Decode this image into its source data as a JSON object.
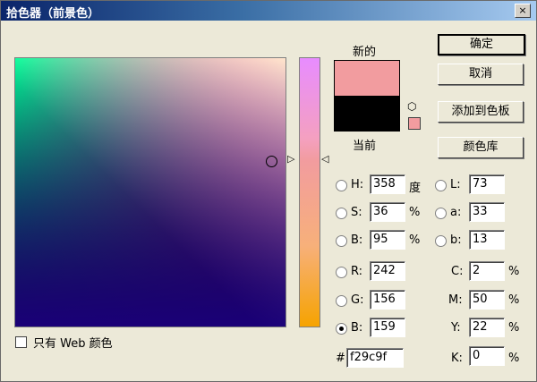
{
  "window": {
    "title": "拾色器（前景色）",
    "close_icon": "×"
  },
  "swatches": {
    "new_label": "新的",
    "current_label": "当前",
    "new_color": "#f29c9f",
    "current_color": "#000000",
    "gamut_color": "#f29c9f"
  },
  "buttons": {
    "ok": "确定",
    "cancel": "取消",
    "add_to_swatches": "添加到色板",
    "color_libraries": "颜色库"
  },
  "hsb": {
    "h_label": "H:",
    "h_value": "358",
    "h_unit": "度",
    "s_label": "S:",
    "s_value": "36",
    "s_unit": "%",
    "b_label": "B:",
    "b_value": "95",
    "b_unit": "%"
  },
  "lab": {
    "l_label": "L:",
    "l_value": "73",
    "a_label": "a:",
    "a_value": "33",
    "b_label": "b:",
    "b_value": "13"
  },
  "rgb": {
    "r_label": "R:",
    "r_value": "242",
    "g_label": "G:",
    "g_value": "156",
    "b_label": "B:",
    "b_value": "159"
  },
  "cmyk": {
    "c_label": "C:",
    "c_value": "2",
    "c_unit": "%",
    "m_label": "M:",
    "m_value": "50",
    "m_unit": "%",
    "y_label": "Y:",
    "y_value": "22",
    "y_unit": "%",
    "k_label": "K:",
    "k_value": "0",
    "k_unit": "%"
  },
  "hex": {
    "label": "#",
    "value": "f29c9f"
  },
  "web_only": {
    "label": "只有 Web 颜色",
    "checked": false
  },
  "selected_mode": "rgb-b"
}
